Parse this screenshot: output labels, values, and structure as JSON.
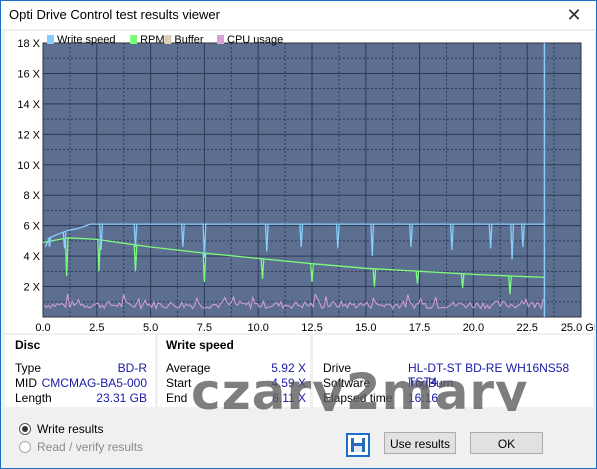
{
  "window": {
    "title": "Opti Drive Control test results viewer",
    "close_glyph": "✕"
  },
  "chart_data": {
    "type": "line",
    "legend": [
      "Write speed",
      "RPM",
      "Buffer",
      "CPU usage"
    ],
    "legend_colors": [
      "#87cefa",
      "#7cfc7c",
      "#d8d0b0",
      "#d8a0d8"
    ],
    "x_unit_label": "GB",
    "xlim": [
      0,
      25
    ],
    "ylim": [
      0,
      18
    ],
    "x_ticks": [
      "0.0",
      "2.5",
      "5.0",
      "7.5",
      "10.0",
      "12.5",
      "15.0",
      "17.5",
      "20.0",
      "22.5",
      "25.0 GB"
    ],
    "y_ticks": [
      "2 X",
      "4 X",
      "6 X",
      "8 X",
      "10 X",
      "12 X",
      "14 X",
      "16 X",
      "18 X"
    ],
    "series": [
      {
        "name": "Write speed",
        "color": "#87cefa",
        "x": [
          0.1,
          0.3,
          0.8,
          1.2,
          1.6,
          2.0,
          2.2,
          5.0,
          10.0,
          15.0,
          20.0,
          23.3
        ],
        "y": [
          4.6,
          5.2,
          5.5,
          5.7,
          5.8,
          6.0,
          6.1,
          6.1,
          6.1,
          6.1,
          6.1,
          6.1
        ],
        "dips_x": [
          0.3,
          1.0,
          2.7,
          4.3,
          6.5,
          7.5,
          10.4,
          12.0,
          13.7,
          15.3,
          17.1,
          19.0,
          20.8,
          21.8,
          22.3
        ],
        "dips_y": [
          4.6,
          4.5,
          4.4,
          4.6,
          4.6,
          3.9,
          4.3,
          4.6,
          4.5,
          4.0,
          4.6,
          4.4,
          4.5,
          3.8,
          4.6
        ]
      },
      {
        "name": "RPM",
        "color": "#7cfc7c",
        "x": [
          0.0,
          1.2,
          2.5,
          5.0,
          7.5,
          10.0,
          12.5,
          15.0,
          17.5,
          20.0,
          22.5,
          23.3
        ],
        "y": [
          4.9,
          5.2,
          5.1,
          4.6,
          4.2,
          3.85,
          3.5,
          3.2,
          3.0,
          2.8,
          2.65,
          2.6
        ],
        "dips_x": [
          1.1,
          2.6,
          4.3,
          7.5,
          10.2,
          12.5,
          15.4,
          17.4,
          19.5,
          21.7
        ],
        "dips_y": [
          2.7,
          3.0,
          3.0,
          2.3,
          2.5,
          2.3,
          2.0,
          2.2,
          1.9,
          1.5
        ]
      },
      {
        "name": "CPU usage",
        "color": "#d8a0d8",
        "baseline": 0.8,
        "noise": 0.25
      }
    ],
    "marker_x": 23.3
  },
  "disc": {
    "header": "Disc",
    "type_label": "Type",
    "type_value": "BD-R",
    "mid_label": "MID",
    "mid_value": "CMCMAG-BA5-000",
    "length_label": "Length",
    "length_value": "23.31 GB"
  },
  "write_speed": {
    "header": "Write speed",
    "average_label": "Average",
    "average_value": "5.92 X",
    "start_label": "Start",
    "start_value": "4.59 X",
    "end_label": "End",
    "end_value": "6.11 X"
  },
  "drive_info": {
    "drive_label": "Drive",
    "drive_value": "HL-DT-ST  BD-RE  WH16NS58 TST4",
    "software_label": "Software",
    "software_value": "ImgBurn",
    "elapsed_label": "Elapsed time",
    "elapsed_value": "16:16"
  },
  "watermark": "czary2mary",
  "options": {
    "write_results": "Write results",
    "read_verify_results": "Read / verify results"
  },
  "buttons": {
    "use_results": "Use results",
    "ok": "OK"
  }
}
